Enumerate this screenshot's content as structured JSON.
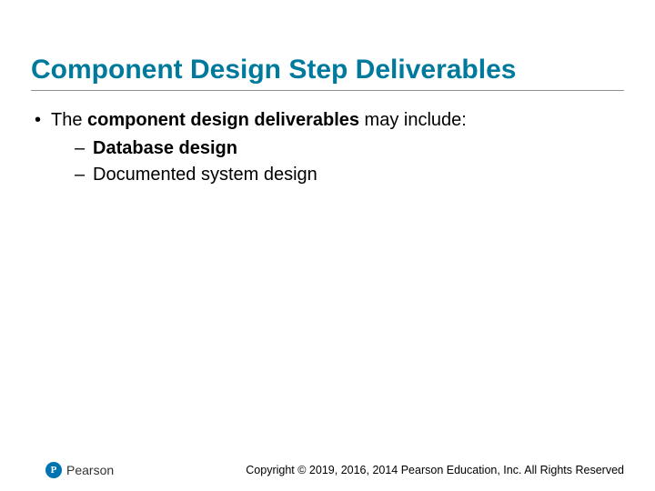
{
  "title": "Component Design Step Deliverables",
  "body": {
    "line1_pre": "The ",
    "line1_bold": "component design deliverables",
    "line1_post": " may include:",
    "sub1": "Database design",
    "sub2": "Documented system design"
  },
  "footer": {
    "logo_letter": "P",
    "logo_text": "Pearson",
    "copyright": "Copyright © 2019, 2016, 2014 Pearson Education, Inc. All Rights Reserved"
  }
}
